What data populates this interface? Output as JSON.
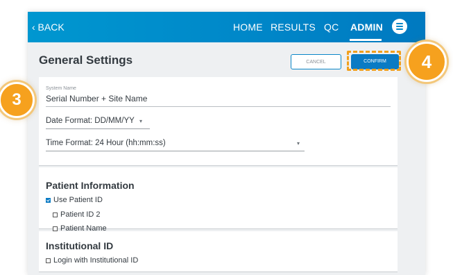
{
  "topbar": {
    "back_label": "‹ BACK",
    "nav": {
      "home": "HOME",
      "results": "RESULTS",
      "qc": "QC",
      "admin": "ADMIN"
    },
    "menu_icon": "menu-icon"
  },
  "header": {
    "title": "General Settings",
    "cancel_label": "CANCEL",
    "confirm_label": "CONFIRM"
  },
  "system": {
    "name_label": "System Name",
    "name_value": "Serial Number + Site Name",
    "date_format": "Date Format:  DD/MM/YY",
    "time_format": "Time Format:  24 Hour (hh:mm:ss)"
  },
  "patient": {
    "title": "Patient Information",
    "options": [
      {
        "label": "Use Patient ID",
        "checked": true
      },
      {
        "label": "Patient ID 2",
        "checked": false
      },
      {
        "label": "Patient Name",
        "checked": false
      }
    ]
  },
  "institutional": {
    "title": "Institutional ID",
    "options": [
      {
        "label": "Login with Institutional ID",
        "checked": false
      }
    ]
  },
  "callouts": {
    "step3": "3",
    "step4": "4"
  },
  "colors": {
    "brand_blue": "#0086c8",
    "confirm_blue": "#0a7bc4",
    "callout_orange": "#f6a11e"
  }
}
